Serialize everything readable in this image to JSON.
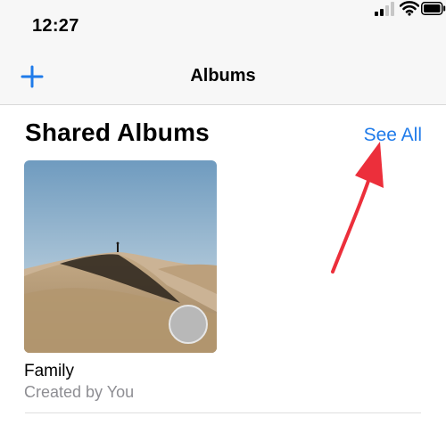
{
  "status_bar": {
    "time": "12:27",
    "icons": [
      "cellular-signal-icon",
      "wifi-icon",
      "battery-icon"
    ]
  },
  "nav": {
    "add_icon": "plus-icon",
    "title": "Albums"
  },
  "shared_albums": {
    "title": "Shared Albums",
    "see_all_label": "See All",
    "albums": [
      {
        "name": "Family",
        "subtitle": "Created by You",
        "thumbnail": "desert-dune-photo",
        "owner_avatar": "avatar"
      }
    ]
  },
  "colors": {
    "accent": "#1f7bea",
    "annotation_arrow": "#ec2f3b",
    "secondary_text": "#8e8e93",
    "bar_background": "#f7f7f7"
  }
}
